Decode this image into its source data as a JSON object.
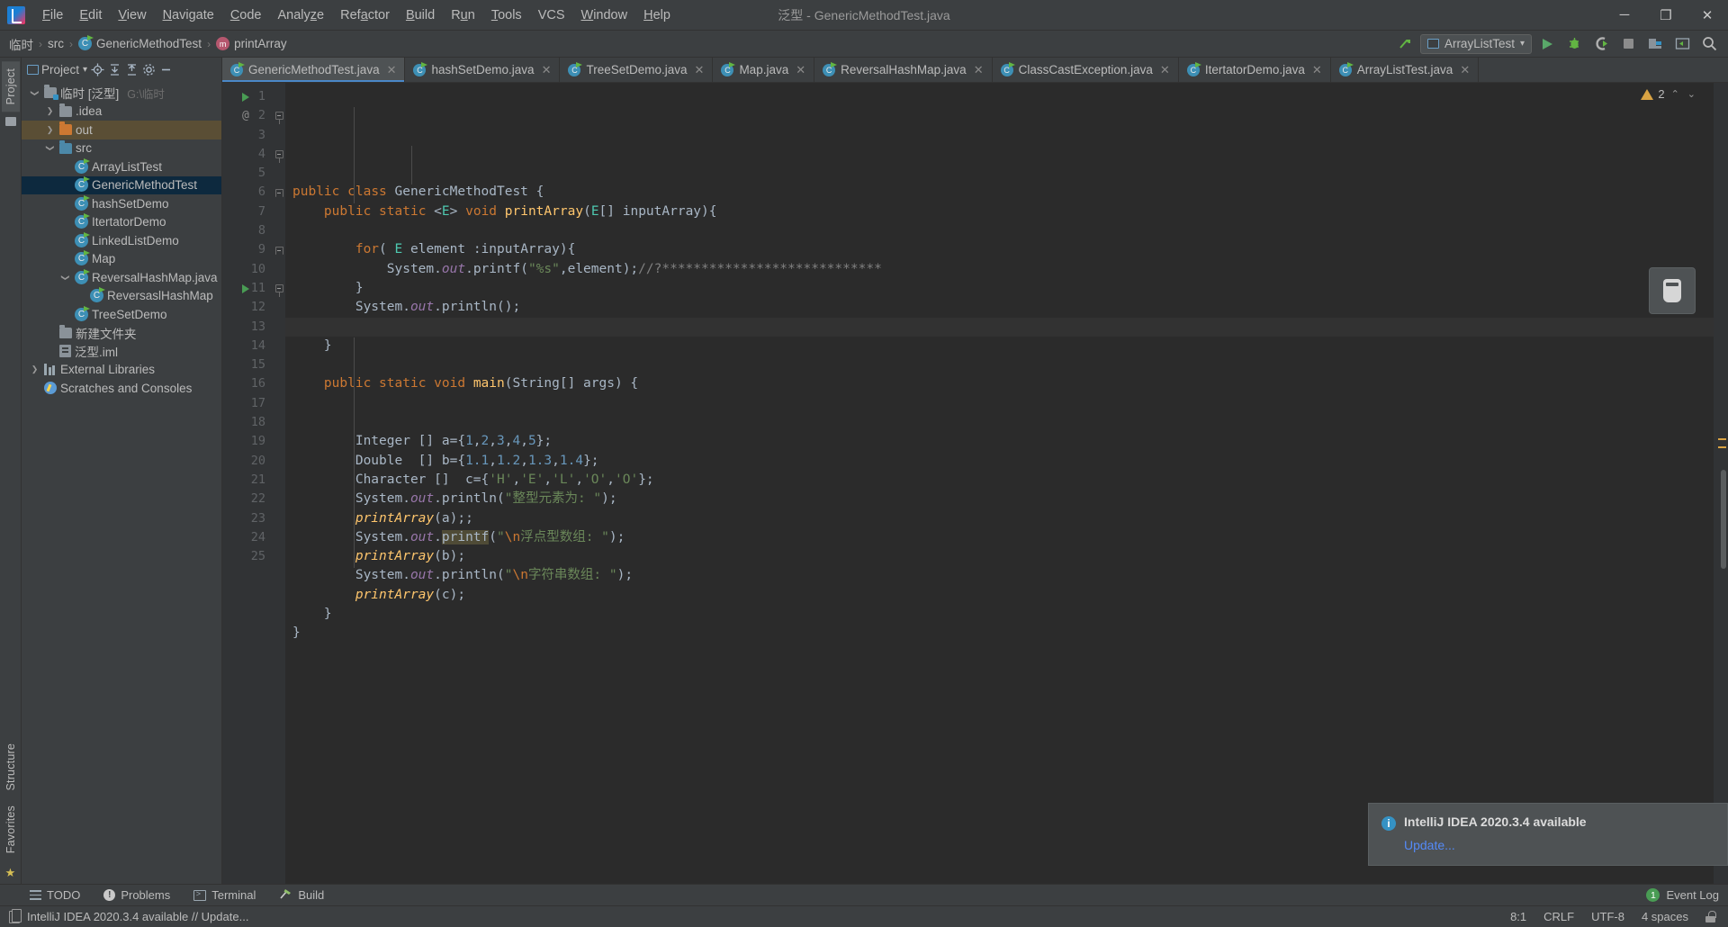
{
  "window": {
    "title": "泛型 - GenericMethodTest.java",
    "logo_icon": "intellij-idea-logo",
    "minimize_icon": "minimize-icon",
    "maximize_icon": "maximize-icon",
    "close_icon": "close-icon",
    "minimize_glyph": "─",
    "maximize_glyph": "❐",
    "close_glyph": "✕"
  },
  "menu": {
    "items": [
      {
        "label": "File"
      },
      {
        "label": "Edit"
      },
      {
        "label": "View"
      },
      {
        "label": "Navigate"
      },
      {
        "label": "Code"
      },
      {
        "label": "Analyze"
      },
      {
        "label": "Refactor"
      },
      {
        "label": "Build"
      },
      {
        "label": "Run"
      },
      {
        "label": "Tools"
      },
      {
        "label": "VCS"
      },
      {
        "label": "Window"
      },
      {
        "label": "Help"
      }
    ]
  },
  "breadcrumb": {
    "items": [
      "临时",
      "src",
      "GenericMethodTest",
      "printArray"
    ],
    "separator": "›"
  },
  "toolbar": {
    "run_config": "ArrayListTest",
    "dropdown_glyph": "▾",
    "run_icon": "run-icon",
    "debug_icon": "debug-icon",
    "run_coverage_icon": "run-with-coverage-icon",
    "stop_icon": "stop-icon",
    "project_structure_icon": "project-structure-icon",
    "hide_window_icon": "hide-window-icon",
    "search_icon": "search-everywhere-icon",
    "updates_icon": "updates-arrow-icon"
  },
  "left_strip": {
    "top_tabs": [
      "Project"
    ],
    "bottom_tabs": [
      "Structure",
      "Favorites"
    ]
  },
  "project_panel": {
    "title": "Project",
    "dropdown_glyph": "▾",
    "actions": [
      "locate-icon",
      "expand-all-icon",
      "collapse-all-icon",
      "settings-gear-icon",
      "hide-icon"
    ],
    "tree": [
      {
        "label": "临时 [泛型]",
        "hint": "G:\\临时",
        "indent": 0,
        "icon": "module-folder",
        "arrow": "down",
        "state": "normal"
      },
      {
        "label": ".idea",
        "hint": "",
        "indent": 1,
        "icon": "folder-gray",
        "arrow": "right",
        "state": "normal"
      },
      {
        "label": "out",
        "hint": "",
        "indent": 1,
        "icon": "folder-orange",
        "arrow": "right",
        "state": "highlight"
      },
      {
        "label": "src",
        "hint": "",
        "indent": 1,
        "icon": "folder-blue",
        "arrow": "down",
        "state": "normal"
      },
      {
        "label": "ArrayListTest",
        "hint": "",
        "indent": 2,
        "icon": "java-class",
        "arrow": "",
        "state": "normal"
      },
      {
        "label": "GenericMethodTest",
        "hint": "",
        "indent": 2,
        "icon": "java-class",
        "arrow": "",
        "state": "selected"
      },
      {
        "label": "hashSetDemo",
        "hint": "",
        "indent": 2,
        "icon": "java-class",
        "arrow": "",
        "state": "normal"
      },
      {
        "label": "ItertatorDemo",
        "hint": "",
        "indent": 2,
        "icon": "java-class",
        "arrow": "",
        "state": "normal"
      },
      {
        "label": "LinkedListDemo",
        "hint": "",
        "indent": 2,
        "icon": "java-class",
        "arrow": "",
        "state": "normal"
      },
      {
        "label": "Map",
        "hint": "",
        "indent": 2,
        "icon": "java-class",
        "arrow": "",
        "state": "normal"
      },
      {
        "label": "ReversalHashMap.java",
        "hint": "",
        "indent": 2,
        "icon": "java-class",
        "arrow": "down",
        "state": "normal"
      },
      {
        "label": "ReversaslHashMap",
        "hint": "",
        "indent": 3,
        "icon": "java-class",
        "arrow": "",
        "state": "normal"
      },
      {
        "label": "TreeSetDemo",
        "hint": "",
        "indent": 2,
        "icon": "java-class",
        "arrow": "",
        "state": "normal"
      },
      {
        "label": "新建文件夹",
        "hint": "",
        "indent": 1,
        "icon": "folder-gray",
        "arrow": "",
        "state": "normal"
      },
      {
        "label": "泛型.iml",
        "hint": "",
        "indent": 1,
        "icon": "iml-file",
        "arrow": "",
        "state": "normal"
      },
      {
        "label": "External Libraries",
        "hint": "",
        "indent": 0,
        "icon": "libraries",
        "arrow": "right",
        "state": "normal"
      },
      {
        "label": "Scratches and Consoles",
        "hint": "",
        "indent": 0,
        "icon": "scratches",
        "arrow": "",
        "state": "normal"
      }
    ]
  },
  "editor_tabs": [
    {
      "label": "GenericMethodTest.java",
      "active": true
    },
    {
      "label": "hashSetDemo.java",
      "active": false
    },
    {
      "label": "TreeSetDemo.java",
      "active": false
    },
    {
      "label": "Map.java",
      "active": false
    },
    {
      "label": "ReversalHashMap.java",
      "active": false
    },
    {
      "label": "ClassCastException.java",
      "active": false
    },
    {
      "label": "ItertatorDemo.java",
      "active": false
    },
    {
      "label": "ArrayListTest.java",
      "active": false
    }
  ],
  "editor": {
    "close_glyph": "✕",
    "warning_count": "2",
    "warning_icon": "warning-triangle-icon",
    "chevron_up_glyph": "⌃",
    "chevron_down_glyph": "⌄",
    "lines": [
      {
        "n": "1",
        "marker": "run",
        "fold": "",
        "text": "public class GenericMethodTest {"
      },
      {
        "n": "2",
        "marker": "at",
        "fold": "open",
        "text": "    public static <E> void printArray(E[] inputArray){"
      },
      {
        "n": "3",
        "marker": "",
        "fold": "",
        "text": ""
      },
      {
        "n": "4",
        "marker": "",
        "fold": "open",
        "text": "        for( E element :inputArray){"
      },
      {
        "n": "5",
        "marker": "",
        "fold": "",
        "text": "            System.out.printf(\"%s\",element);//?****************************"
      },
      {
        "n": "6",
        "marker": "",
        "fold": "end",
        "text": "        }"
      },
      {
        "n": "7",
        "marker": "",
        "fold": "",
        "text": "        System.out.println();"
      },
      {
        "n": "8",
        "marker": "",
        "fold": "",
        "text": ""
      },
      {
        "n": "9",
        "marker": "",
        "fold": "end",
        "text": "    }"
      },
      {
        "n": "10",
        "marker": "",
        "fold": "",
        "text": ""
      },
      {
        "n": "11",
        "marker": "run",
        "fold": "open",
        "text": "    public static void main(String[] args) {"
      },
      {
        "n": "12",
        "marker": "",
        "fold": "",
        "text": ""
      },
      {
        "n": "13",
        "marker": "",
        "fold": "",
        "text": ""
      },
      {
        "n": "14",
        "marker": "",
        "fold": "",
        "text": "        Integer [] a={1,2,3,4,5};"
      },
      {
        "n": "15",
        "marker": "",
        "fold": "",
        "text": "        Double  [] b={1.1,1.2,1.3,1.4};"
      },
      {
        "n": "16",
        "marker": "",
        "fold": "",
        "text": "        Character []  c={'H','E','L','O','O'};"
      },
      {
        "n": "17",
        "marker": "",
        "fold": "",
        "text": "        System.out.println(\"整型元素为: \");"
      },
      {
        "n": "18",
        "marker": "",
        "fold": "",
        "text": "        printArray(a);;"
      },
      {
        "n": "19",
        "marker": "",
        "fold": "",
        "text": "        System.out.printf(\"\\n浮点型数组: \");"
      },
      {
        "n": "20",
        "marker": "",
        "fold": "",
        "text": "        printArray(b);"
      },
      {
        "n": "21",
        "marker": "",
        "fold": "",
        "text": "        System.out.println(\"\\n字符串数组: \");"
      },
      {
        "n": "22",
        "marker": "",
        "fold": "",
        "text": "        printArray(c);"
      },
      {
        "n": "23",
        "marker": "",
        "fold": "",
        "text": "    }"
      },
      {
        "n": "24",
        "marker": "",
        "fold": "",
        "text": "}"
      },
      {
        "n": "25",
        "marker": "",
        "fold": "",
        "text": ""
      }
    ],
    "code_lens_icon": "code-preview-icon"
  },
  "notification": {
    "icon": "info-icon",
    "title": "IntelliJ IDEA 2020.3.4 available",
    "link": "Update..."
  },
  "tool_windows": [
    {
      "label": "TODO",
      "icon": "todo-icon"
    },
    {
      "label": "Problems",
      "icon": "problems-icon"
    },
    {
      "label": "Terminal",
      "icon": "terminal-icon"
    },
    {
      "label": "Build",
      "icon": "build-hammer-icon"
    }
  ],
  "event_log": {
    "count": "1",
    "label": "Event Log"
  },
  "status_bar": {
    "message": "IntelliJ IDEA 2020.3.4 available // Update...",
    "message_icon": "notification-icon",
    "caret": "8:1",
    "line_separator": "CRLF",
    "encoding": "UTF-8",
    "indent": "4 spaces",
    "lock_icon": "unlocked-icon"
  },
  "colors": {
    "accent": "#4a88c7",
    "keyword": "#cc7832",
    "method": "#ffc66d",
    "string": "#6a8759",
    "number": "#6897bb",
    "field": "#9876aa",
    "comment": "#808080",
    "generic": "#4ec9b0",
    "selection": "#0d293e",
    "editor_bg": "#2b2b2b",
    "panel_bg": "#3c3f41",
    "link": "#548af7",
    "run_green": "#499c54",
    "warning": "#d9a343"
  }
}
